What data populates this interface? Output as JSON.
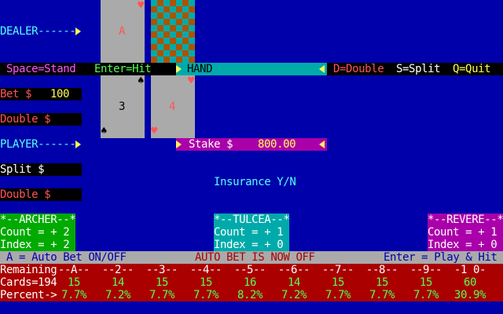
{
  "dealer": {
    "label": "DEALER------"
  },
  "player": {
    "label": "PLAYER------"
  },
  "cards": {
    "dealer_up": {
      "rank": "A",
      "suit": "heart"
    },
    "player_1": {
      "rank": "3",
      "suit": "spade"
    },
    "player_2": {
      "rank": "4",
      "suit": "heart"
    }
  },
  "command_bar": {
    "stand": "Space=Stand",
    "hit": "Enter=Hit",
    "hand": "HAND",
    "double": "D=Double",
    "split": "S=Split",
    "quit": "Q=Quit"
  },
  "bets": {
    "bet_label": "Bet $",
    "bet_value": "100",
    "double1_label": "Double $",
    "split_label": "Split $",
    "double2_label": "Double $"
  },
  "stake": {
    "label": "Stake $",
    "value": "800.00"
  },
  "insurance": "Insurance Y/N",
  "counters": [
    {
      "title": "*--ARCHER--*",
      "count": "Count = + 2",
      "index": "Index = + 2",
      "color": "#00aa00"
    },
    {
      "title": "*--TULCEA--*",
      "count": "Count = + 1",
      "index": "Index = + 0",
      "color": "#00aaaa"
    },
    {
      "title": "*--REVERE--*",
      "count": "Count = + 1",
      "index": "Index = + 0",
      "color": "#aa00aa"
    }
  ],
  "status_bar": {
    "autobet_key": "A = Auto Bet ON/OFF",
    "autobet_state": "AUTO BET IS NOW OFF",
    "play_hit": "Enter = Play & Hit"
  },
  "table": {
    "remaining_label": "Remaining",
    "cards_label": "Cards=194",
    "percent_label": "Percent->",
    "columns": [
      "--A--",
      "--2--",
      "--3--",
      "--4--",
      "--5--",
      "--6--",
      "--7--",
      "--8--",
      "--9--",
      "-1 0-"
    ],
    "counts": [
      "15",
      "14",
      "15",
      "15",
      "16",
      "14",
      "15",
      "15",
      "15",
      "60"
    ],
    "percents": [
      "7.7%",
      "7.2%",
      "7.7%",
      "7.7%",
      "8.2%",
      "7.2%",
      "7.7%",
      "7.7%",
      "7.7%",
      "30.9%"
    ]
  }
}
